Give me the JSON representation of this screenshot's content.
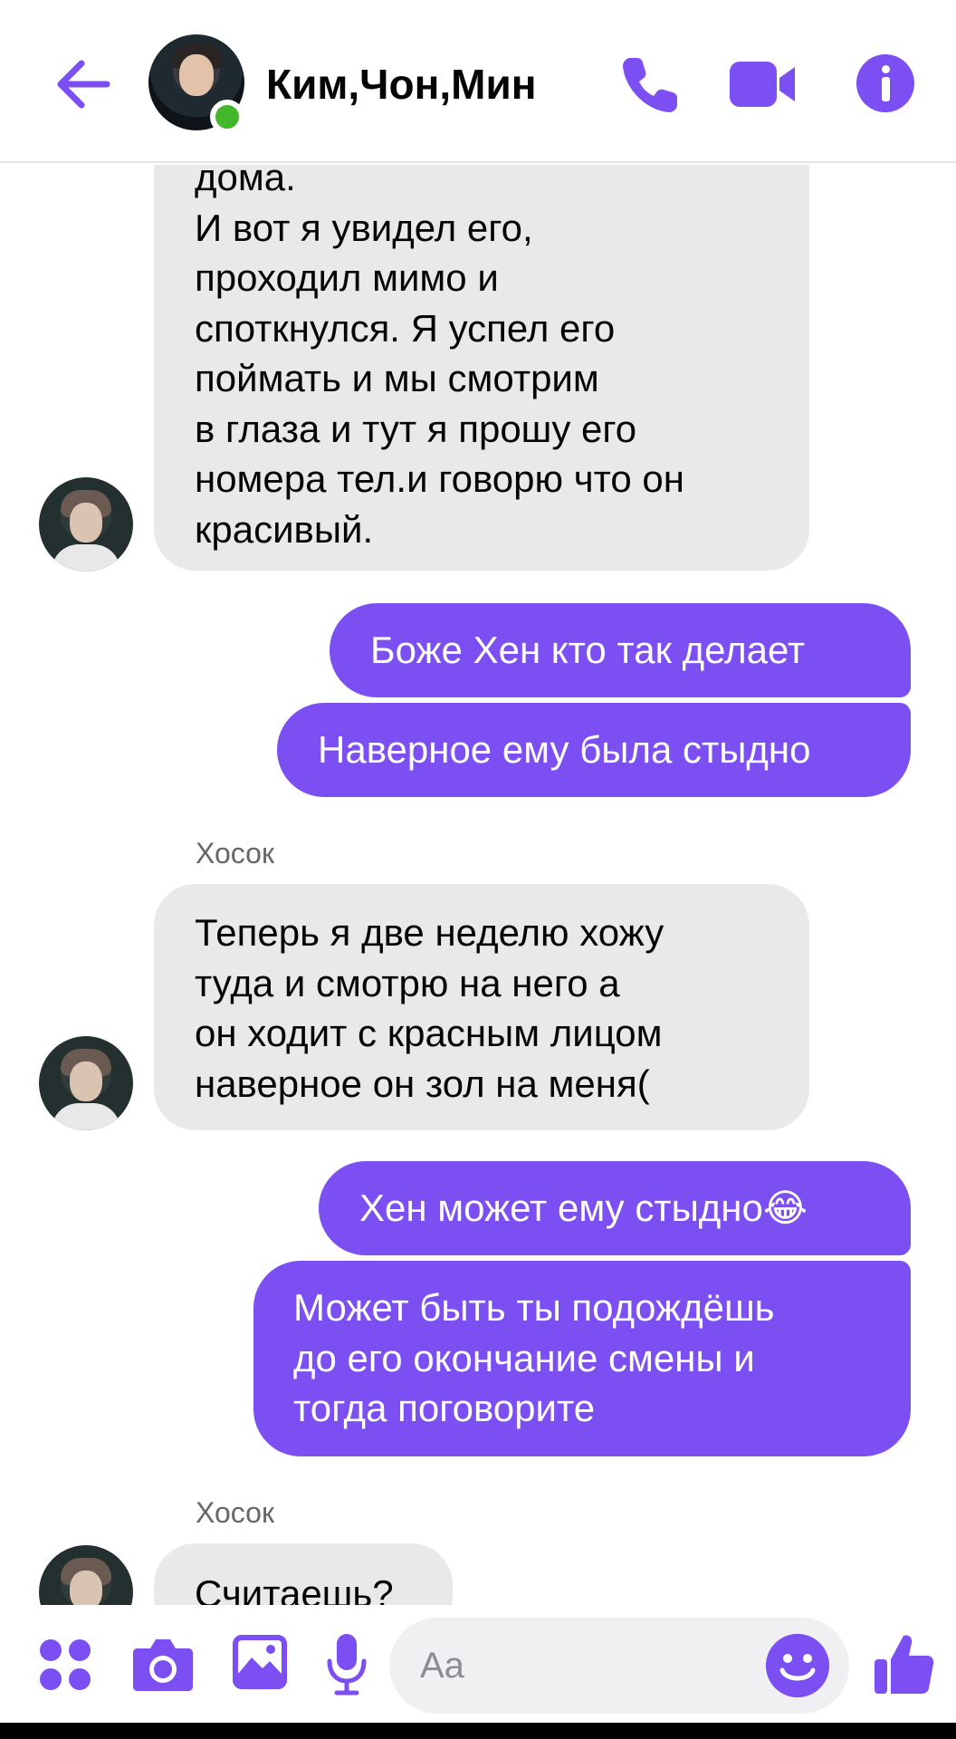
{
  "header": {
    "title": "Ким,Чон,Мин",
    "back_icon": "arrow-left-icon",
    "call_icon": "phone-icon",
    "video_icon": "video-camera-icon",
    "info_icon": "info-icon",
    "online": true
  },
  "messages": [
    {
      "dir": "in",
      "text": "дома.\nИ вот я увидел его,\nпроходил мимо и\nспоткнулся. Я успел его\nпоймать и мы смотрим\nв глаза и тут я прошу его\nномера тел.и говорю что он\nкрасивый."
    },
    {
      "dir": "out",
      "text": "Боже Хен кто так делает"
    },
    {
      "dir": "out",
      "text": "Наверное ему была стыдно"
    },
    {
      "dir": "in",
      "sender": "Хосок",
      "text": "Теперь я две неделю хожу\nтуда и смотрю на него а\nон ходит с красным лицом\nнаверное он зол на меня("
    },
    {
      "dir": "out",
      "text": "Хен может ему стыдно😂"
    },
    {
      "dir": "out",
      "text": "Может быть ты подождёшь\nдо его окончание смены и\nтогда поговорите"
    },
    {
      "dir": "in",
      "sender": "Хосок",
      "text": "Считаешь?"
    }
  ],
  "composer": {
    "placeholder": "Aa",
    "value": "",
    "icons": [
      "apps-icon",
      "camera-icon",
      "gallery-icon",
      "microphone-icon",
      "emoji-icon",
      "thumbs-up-icon"
    ]
  },
  "colors": {
    "accent": "#7b4ff2",
    "incoming_bubble": "#e9e9ec",
    "online": "#42b72a",
    "secondary_text": "#65676b"
  }
}
